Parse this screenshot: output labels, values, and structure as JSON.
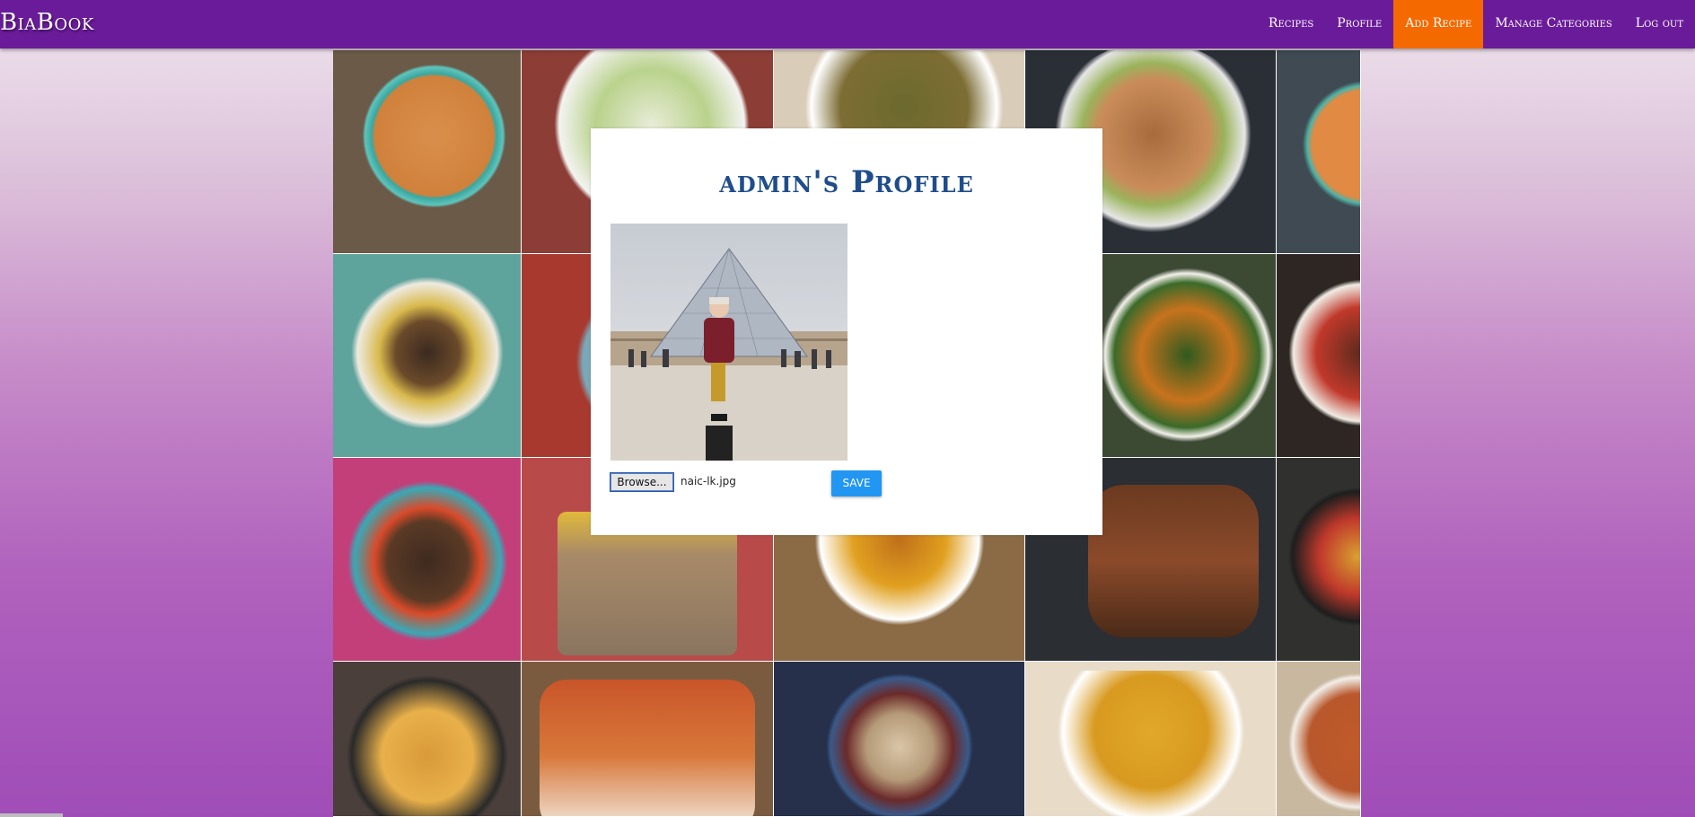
{
  "navbar": {
    "brand": "BiaBook",
    "links": [
      {
        "label": "Recipes",
        "active": false
      },
      {
        "label": "Profile",
        "active": false
      },
      {
        "label": "Add Recipe",
        "active": true
      },
      {
        "label": "Manage Categories",
        "active": false
      },
      {
        "label": "Log out",
        "active": false
      }
    ]
  },
  "modal": {
    "title": "admin's Profile",
    "browse_label": "Browse...",
    "file_name": "naic-lk.jpg",
    "save_label": "SAVE"
  },
  "colors": {
    "navbar": "#6a1b9a",
    "active_link": "#f46a00",
    "title": "#1f4d8c",
    "save_button": "#2196f3"
  }
}
